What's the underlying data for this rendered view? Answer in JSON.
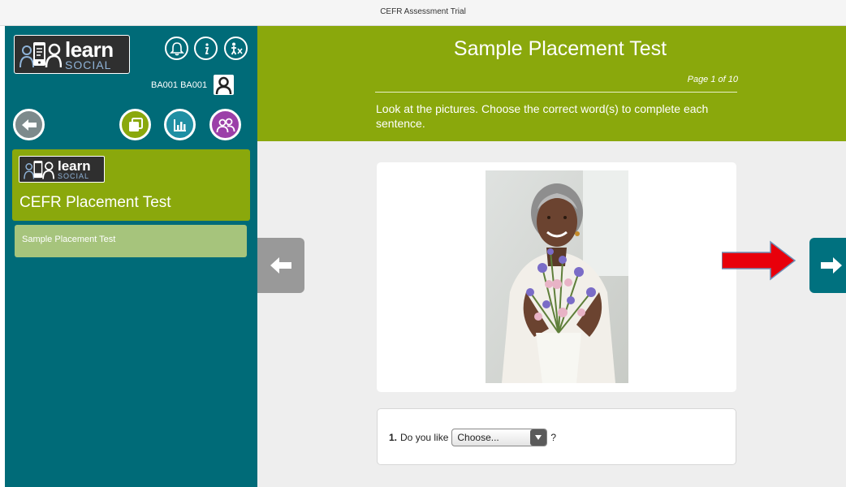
{
  "window": {
    "title": "CEFR Assessment Trial"
  },
  "sidebar": {
    "logo": {
      "word": "learn",
      "sub": "SOCIAL"
    },
    "user_id": "BA001 BA001",
    "header_icons": [
      "bell-icon",
      "info-icon",
      "accessibility-icon"
    ],
    "nav_buttons": [
      "back-arrow-icon",
      "copies-icon",
      "stats-icon",
      "group-icon"
    ],
    "course": {
      "logo_word": "learn",
      "logo_sub": "SOCIAL",
      "title": "CEFR Placement Test"
    },
    "lessons": [
      {
        "label": "Sample Placement Test"
      }
    ]
  },
  "header": {
    "title": "Sample Placement Test",
    "page_indicator": "Page 1 of 10",
    "instructions": "Look at the pictures. Choose the correct word(s) to complete each sentence."
  },
  "question": {
    "number": "1.",
    "prefix": "Do you like",
    "select_value": "Choose...",
    "suffix": "?"
  },
  "colors": {
    "sidebar": "#006b78",
    "header": "#8aa80c",
    "next_button": "#00717f",
    "highlight_arrow": "#e8000b"
  }
}
